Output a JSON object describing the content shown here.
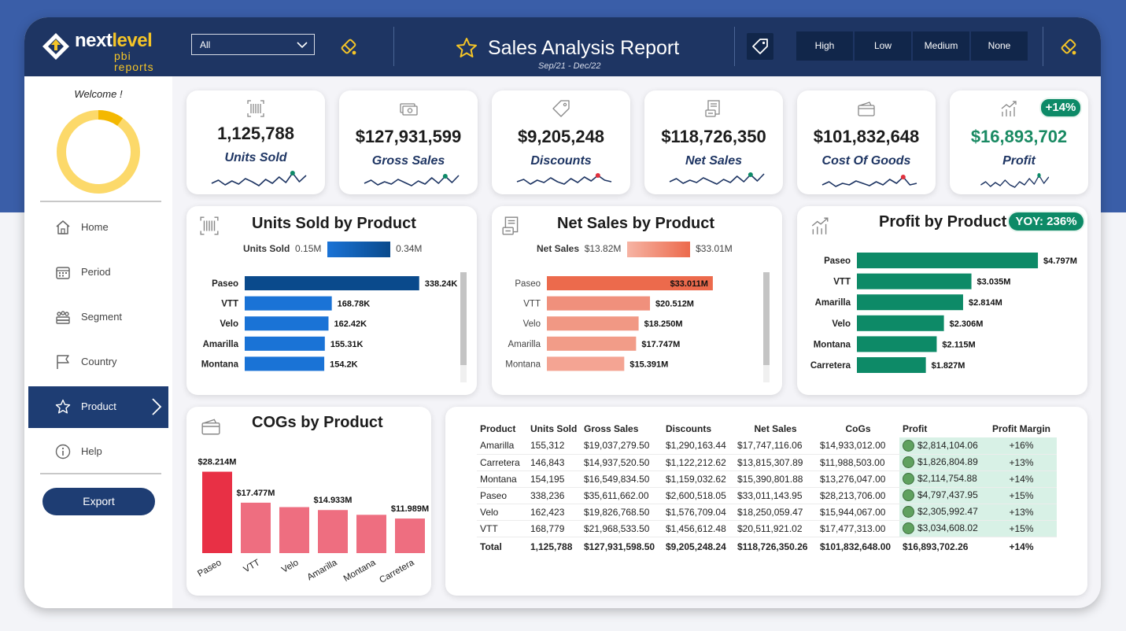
{
  "header": {
    "logo_brand_next": "next",
    "logo_brand_level": "level",
    "logo_sub": "pbi reports",
    "filter_value": "All",
    "title": "Sales Analysis Report",
    "period": "Sep/21 - Dec/22",
    "priority_buttons": [
      "High",
      "Low",
      "Medium",
      "None"
    ]
  },
  "sidebar": {
    "welcome": "Welcome !",
    "donut_fraction": 0.1,
    "nav": [
      {
        "label": "Home",
        "icon": "home-icon"
      },
      {
        "label": "Period",
        "icon": "calendar-icon"
      },
      {
        "label": "Segment",
        "icon": "people-icon"
      },
      {
        "label": "Country",
        "icon": "flag-icon"
      },
      {
        "label": "Product",
        "icon": "star-icon",
        "active": true
      },
      {
        "label": "Help",
        "icon": "info-icon"
      }
    ],
    "export_label": "Export"
  },
  "kpis": [
    {
      "value": "1,125,788",
      "label": "Units Sold",
      "icon": "barcode-icon",
      "marker": "#0d8a67",
      "spark": [
        22,
        18,
        24,
        19,
        23,
        16,
        20,
        25,
        17,
        22,
        14,
        21,
        9,
        20,
        12
      ]
    },
    {
      "value": "$127,931,599",
      "label": "Gross Sales",
      "icon": "money-icon",
      "marker": "#0d8a67",
      "spark": [
        20,
        16,
        22,
        18,
        21,
        15,
        19,
        23,
        17,
        21,
        13,
        20,
        11,
        19,
        10
      ]
    },
    {
      "value": "$9,205,248",
      "label": "Discounts",
      "icon": "price-tag-icon",
      "marker": "#e0303d",
      "spark": [
        20,
        17,
        23,
        18,
        21,
        15,
        20,
        23,
        16,
        21,
        14,
        19,
        12,
        18,
        20
      ]
    },
    {
      "value": "$118,726,350",
      "label": "Net Sales",
      "icon": "receipt-icon",
      "marker": "#0d8a67",
      "spark": [
        20,
        16,
        22,
        18,
        21,
        15,
        19,
        23,
        17,
        21,
        13,
        20,
        11,
        19,
        10
      ]
    },
    {
      "value": "$101,832,648",
      "label": "Cost Of Goods",
      "icon": "card-icon",
      "marker": "#e0303d",
      "spark": [
        22,
        18,
        24,
        20,
        22,
        17,
        20,
        23,
        18,
        22,
        15,
        20,
        12,
        22,
        20
      ]
    },
    {
      "value": "$16,893,702",
      "label": "Profit",
      "icon": "growth-chart-icon",
      "marker": "#0d8a67",
      "badge": "+14%",
      "spark": [
        22,
        18,
        24,
        19,
        23,
        16,
        22,
        25,
        18,
        22,
        14,
        21,
        10,
        20,
        12
      ]
    }
  ],
  "charts": {
    "units": {
      "title": "Units Sold by Product",
      "legend_label": "Units Sold",
      "legend_min": "0.15M",
      "legend_max": "0.34M",
      "bar_labels": [
        "338.24K",
        "168.78K",
        "162.42K",
        "155.31K",
        "154.2K"
      ]
    },
    "net": {
      "title": "Net Sales by Product",
      "legend_label": "Net Sales",
      "legend_min": "$13.82M",
      "legend_max": "$33.01M",
      "bar_labels": [
        "$33.011M",
        "$20.512M",
        "$18.250M",
        "$17.747M",
        "$15.391M"
      ]
    },
    "profit": {
      "title": "Profit by Product",
      "badge": "YOY: 236%",
      "bar_labels": [
        "$4.797M",
        "$3.035M",
        "$2.814M",
        "$2.306M",
        "$2.115M",
        "$1.827M"
      ]
    },
    "cogs": {
      "title": "COGs by Product",
      "data_labels": [
        "$28.214M",
        "$17.477M",
        "",
        "$14.933M",
        "",
        "$11.989M"
      ]
    }
  },
  "chart_data": [
    {
      "type": "bar",
      "orientation": "horizontal",
      "title": "Units Sold by Product",
      "categories": [
        "Paseo",
        "VTT",
        "Velo",
        "Amarilla",
        "Montana"
      ],
      "values": [
        338240,
        168780,
        162420,
        155310,
        154200
      ],
      "colors": [
        "#0a4a8c",
        "#1a73d6",
        "#1a73d6",
        "#1a73d6",
        "#1a73d6"
      ],
      "xlim": [
        0,
        360000
      ]
    },
    {
      "type": "bar",
      "orientation": "horizontal",
      "title": "Net Sales by Product",
      "categories": [
        "Paseo",
        "VTT",
        "Velo",
        "Amarilla",
        "Montana"
      ],
      "values": [
        33.011,
        20.512,
        18.25,
        17.747,
        15.391
      ],
      "colors": [
        "#ec6a4c",
        "#f0907c",
        "#f19884",
        "#f29c88",
        "#f4a493"
      ],
      "xlim": [
        0,
        36
      ]
    },
    {
      "type": "bar",
      "orientation": "horizontal",
      "title": "Profit by Product",
      "categories": [
        "Paseo",
        "VTT",
        "Amarilla",
        "Velo",
        "Montana",
        "Carretera"
      ],
      "values": [
        4.797,
        3.035,
        2.814,
        2.306,
        2.115,
        1.827
      ],
      "color": "#0d8a67",
      "xlim": [
        0,
        4.9
      ]
    },
    {
      "type": "bar",
      "orientation": "vertical",
      "title": "COGs by Product",
      "categories": [
        "Paseo",
        "VTT",
        "Velo",
        "Amarilla",
        "Montana",
        "Carretera"
      ],
      "values": [
        28.214,
        17.477,
        15.944,
        14.933,
        13.276,
        11.989
      ],
      "colors": [
        "#e83045",
        "#ee6e80",
        "#ee6e80",
        "#ee6e80",
        "#ee6e80",
        "#ee6e80"
      ],
      "ylim": [
        0,
        30
      ]
    }
  ],
  "table": {
    "columns": [
      "Product",
      "Units Sold",
      "Gross Sales",
      "Discounts",
      "Net Sales",
      "CoGs",
      "Profit",
      "Profit Margin"
    ],
    "rows": [
      [
        "Amarilla",
        "155,312",
        "$19,037,279.50",
        "$1,290,163.44",
        "$17,747,116.06",
        "$14,933,012.00",
        "$2,814,104.06",
        "+16%"
      ],
      [
        "Carretera",
        "146,843",
        "$14,937,520.50",
        "$1,122,212.62",
        "$13,815,307.89",
        "$11,988,503.00",
        "$1,826,804.89",
        "+13%"
      ],
      [
        "Montana",
        "154,195",
        "$16,549,834.50",
        "$1,159,032.62",
        "$15,390,801.88",
        "$13,276,047.00",
        "$2,114,754.88",
        "+14%"
      ],
      [
        "Paseo",
        "338,236",
        "$35,611,662.00",
        "$2,600,518.05",
        "$33,011,143.95",
        "$28,213,706.00",
        "$4,797,437.95",
        "+15%"
      ],
      [
        "Velo",
        "162,423",
        "$19,826,768.50",
        "$1,576,709.04",
        "$18,250,059.47",
        "$15,944,067.00",
        "$2,305,992.47",
        "+13%"
      ],
      [
        "VTT",
        "168,779",
        "$21,968,533.50",
        "$1,456,612.48",
        "$20,511,921.02",
        "$17,477,313.00",
        "$3,034,608.02",
        "+15%"
      ]
    ],
    "total": [
      "Total",
      "1,125,788",
      "$127,931,598.50",
      "$9,205,248.24",
      "$118,726,350.26",
      "$101,832,648.00",
      "$16,893,702.26",
      "+14%"
    ]
  }
}
